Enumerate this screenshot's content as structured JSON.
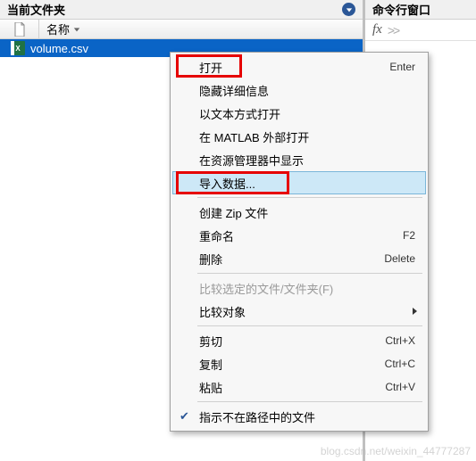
{
  "leftPanel": {
    "title": "当前文件夹",
    "columnLabel": "名称",
    "file": "volume.csv"
  },
  "rightPanel": {
    "title": "命令行窗口",
    "fx": "fx",
    "prompt": ">>"
  },
  "menu": {
    "open": "打开",
    "openSc": "Enter",
    "hideDetail": "隐藏详细信息",
    "openAsText": "以文本方式打开",
    "openOutside": "在 MATLAB 外部打开",
    "showInExplorer": "在资源管理器中显示",
    "importData": "导入数据...",
    "createZip": "创建 Zip 文件",
    "rename": "重命名",
    "renameSc": "F2",
    "delete": "删除",
    "deleteSc": "Delete",
    "compareSelected": "比较选定的文件/文件夹(F)",
    "compareTarget": "比较对象",
    "cut": "剪切",
    "cutSc": "Ctrl+X",
    "copy": "复制",
    "copySc": "Ctrl+C",
    "paste": "粘贴",
    "pasteSc": "Ctrl+V",
    "indicateNotOnPath": "指示不在路径中的文件"
  },
  "watermark": "blog.csdn.net/weixin_44777287"
}
